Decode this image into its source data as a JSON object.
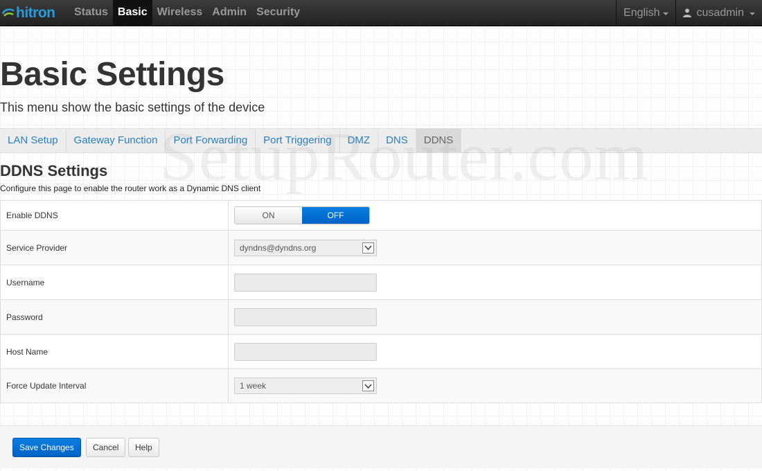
{
  "brand": {
    "name": "hitron",
    "color": "#2a9bd8"
  },
  "nav": {
    "items": [
      {
        "label": "Status",
        "active": false
      },
      {
        "label": "Basic",
        "active": true
      },
      {
        "label": "Wireless",
        "active": false
      },
      {
        "label": "Admin",
        "active": false
      },
      {
        "label": "Security",
        "active": false
      }
    ],
    "language": "English",
    "user": "cusadmin"
  },
  "page": {
    "title": "Basic Settings",
    "subtitle": "This menu show the basic settings of the device"
  },
  "tabs": [
    {
      "label": "LAN Setup",
      "active": false
    },
    {
      "label": "Gateway Function",
      "active": false
    },
    {
      "label": "Port Forwarding",
      "active": false
    },
    {
      "label": "Port Triggering",
      "active": false
    },
    {
      "label": "DMZ",
      "active": false
    },
    {
      "label": "DNS",
      "active": false
    },
    {
      "label": "DDNS",
      "active": true
    }
  ],
  "watermark": "SetupRouter.com",
  "section": {
    "title": "DDNS Settings",
    "description": "Configure this page to enable the router work as a Dynamic DNS client"
  },
  "fields": {
    "enable_ddns": {
      "label": "Enable DDNS",
      "on_label": "ON",
      "off_label": "OFF",
      "selected": "OFF"
    },
    "service_provider": {
      "label": "Service Provider",
      "value": "dyndns@dyndns.org"
    },
    "username": {
      "label": "Username",
      "value": ""
    },
    "password": {
      "label": "Password",
      "value": ""
    },
    "host_name": {
      "label": "Host Name",
      "value": ""
    },
    "force_update_interval": {
      "label": "Force Update Interval",
      "value": "1 week"
    }
  },
  "actions": {
    "save": "Save Changes",
    "cancel": "Cancel",
    "help": "Help"
  },
  "colors": {
    "accent": "#0a74da",
    "link": "#2a7fc1",
    "navbar": "#2b2b2b"
  }
}
